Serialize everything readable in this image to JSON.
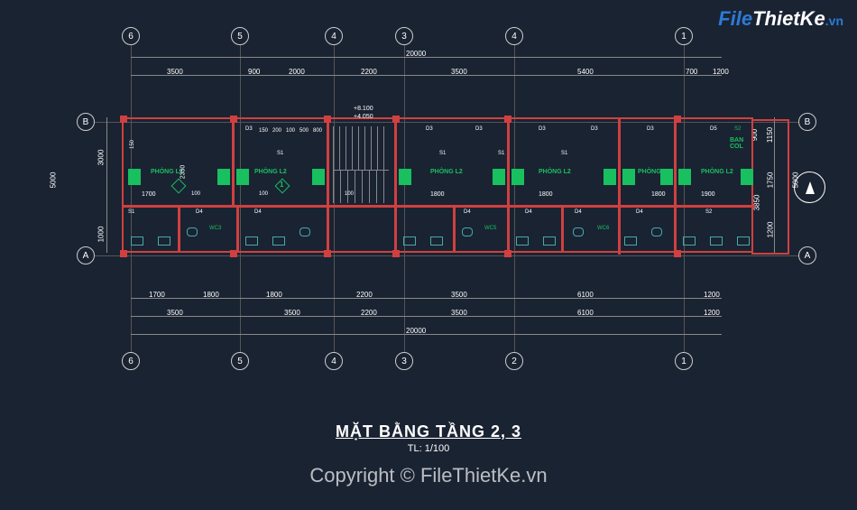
{
  "logo": {
    "file": "File",
    "thietke": "ThietKe",
    "vn": ".vn"
  },
  "copyright": "Copyright © FileThietKe.vn",
  "title": {
    "main": "MẶT BẰNG TẦNG 2, 3",
    "scale": "TL: 1/100"
  },
  "grid_axes": {
    "vertical": [
      "6",
      "5",
      "4",
      "3",
      "2",
      "1"
    ],
    "horizontal": [
      "B",
      "A"
    ]
  },
  "dims": {
    "overall_h": "20000",
    "overall_v": "5000",
    "top_row1": [
      "3500",
      "900",
      "2000",
      "2200",
      "3500",
      "5400",
      "700",
      "1200"
    ],
    "top_row2": [
      "150",
      "200",
      "100",
      "500",
      "800",
      "200",
      "100",
      "150"
    ],
    "bottom_row1": [
      "1700",
      "1800",
      "1800",
      "2200",
      "3500",
      "6100",
      "1200"
    ],
    "bottom_row2": [
      "1700",
      "100",
      "1800",
      "100",
      "100",
      "100",
      "1800",
      "100",
      "1800",
      "100",
      "1800",
      "100",
      "700"
    ],
    "left": [
      "1000",
      "3000"
    ],
    "left_inner": [
      "150",
      "2350"
    ],
    "right": [
      "900",
      "1200",
      "1750",
      "1150",
      "3850"
    ],
    "bottom_overall": "20000"
  },
  "rooms": {
    "phong_l3": "PHÒNG L3",
    "phong_l2": "PHÒNG L2",
    "wc3": "WC3",
    "wc5": "WC5",
    "wc6": "WC6",
    "bancol": "BAN COL"
  },
  "doors": {
    "d3": "D3",
    "d4": "D4",
    "d5": "D5",
    "s1": "S1",
    "s2": "S2"
  },
  "levels": {
    "up": "+8.100",
    "down": "+4.050"
  },
  "north_label": "N",
  "room_marker": "1"
}
